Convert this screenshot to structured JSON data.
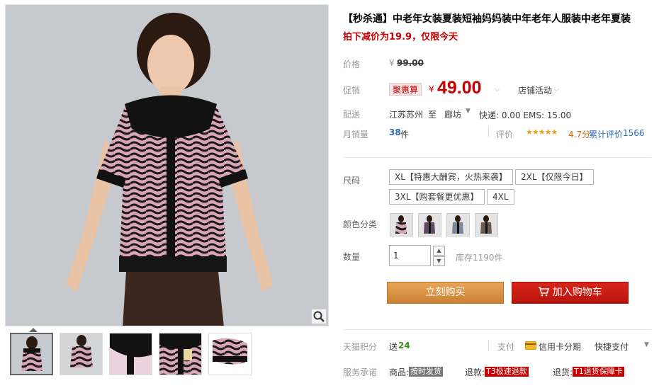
{
  "title": "【秒杀通】中老年女装夏装短袖妈妈装中年老年人服装中老年夏装",
  "subtitle": "拍下减价为19.9，仅限今天",
  "price": {
    "label": "价格",
    "currency": "¥",
    "original": "99.00"
  },
  "promo": {
    "label": "促销",
    "tag": "聚惠算",
    "currency": "¥",
    "price": "49.00",
    "store_activity": "店铺活动"
  },
  "shipping": {
    "label": "配送",
    "from": "江苏苏州",
    "to_word": "至",
    "dest": "廊坊",
    "fees": "快递: 0.00 EMS: 15.00"
  },
  "sales": {
    "label": "月销量",
    "count": "38",
    "unit": "件",
    "rating_label": "评价",
    "rating": "★★★★★",
    "rating_score": "4.7分",
    "cumulative": "累计评价",
    "review_count": "1566"
  },
  "size": {
    "label": "尺码",
    "options": [
      "XL【特惠大酬宾，火热来袭】",
      "2XL【仅限今日】",
      "3XL【购套餐更优惠】",
      "4XL"
    ]
  },
  "color": {
    "label": "颜色分类"
  },
  "quantity": {
    "label": "数量",
    "value": "1",
    "stock": "库存1190件"
  },
  "actions": {
    "buy": "立刻购买",
    "cart": "加入购物车"
  },
  "points": {
    "label": "天猫积分",
    "give": "送",
    "amount": "24",
    "pay_label": "支付",
    "credit": "信用卡分期",
    "quick_pay": "快捷支付"
  },
  "service": {
    "label": "服务承诺",
    "goods": "商品:",
    "goods_tag": "按时发货",
    "refund": "退款:",
    "refund_tag": "T3极速退款",
    "return": "退货:",
    "return_tag": "T1退货保障卡"
  },
  "colors": {
    "accent_red": "#c40000",
    "buy_orange": "#e5994a",
    "cart_red": "#c8190e",
    "star_gold": "#e8a317",
    "link_blue": "#2d6cb5"
  }
}
